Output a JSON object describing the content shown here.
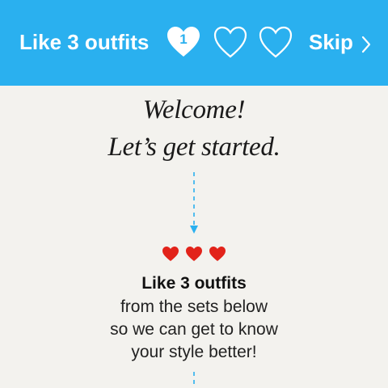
{
  "header": {
    "title": "Like 3 outfits",
    "liked_count": "1",
    "skip_label": "Skip",
    "background_color": "#2ab0ef"
  },
  "welcome": {
    "line1": "Welcome!",
    "line2": "Let’s get started."
  },
  "instructions": {
    "headline": "Like 3 outfits",
    "lines": [
      "from the sets below",
      "so we can get to know",
      "your style better!"
    ]
  },
  "icons": {
    "heart_filled": "heart-filled-icon",
    "heart_outline": "heart-outline-icon",
    "skip_chevron": "chevron-right-icon",
    "small_heart": "red-heart-icon"
  },
  "colors": {
    "accent": "#2ab0ef",
    "heart_red": "#e2231a",
    "text": "#1a1a1a"
  }
}
